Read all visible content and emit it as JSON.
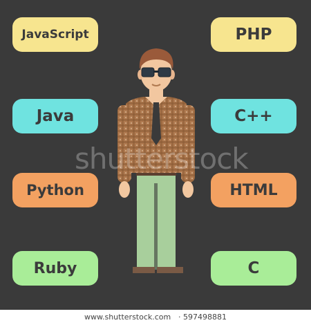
{
  "colors": {
    "background": "#3a3a3a",
    "yellow": "#f7e58f",
    "cyan": "#6fe3e0",
    "orange": "#f3a161",
    "green": "#a9ed98"
  },
  "left_labels": [
    "JavaScript",
    "Java",
    "Python",
    "Ruby"
  ],
  "right_labels": [
    "PHP",
    "C++",
    "HTML",
    "C"
  ],
  "watermark": "shutterstock",
  "footer": {
    "site": "www.shutterstock.com",
    "separator": " · ",
    "image_id": "597498881"
  }
}
